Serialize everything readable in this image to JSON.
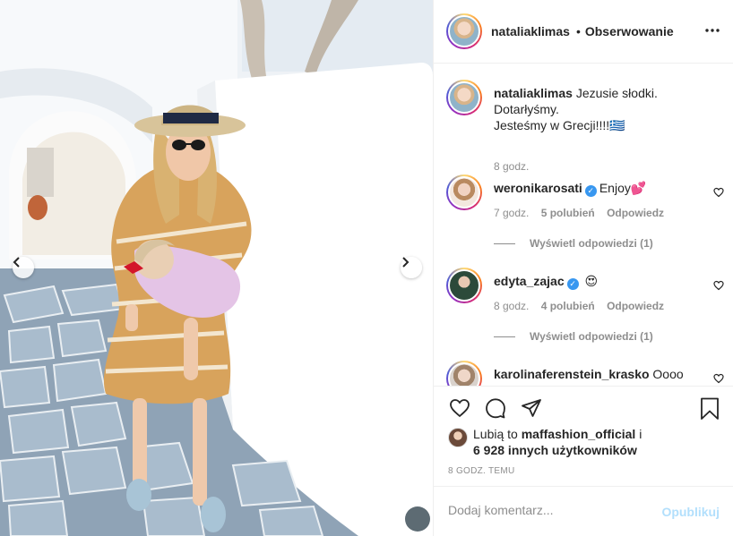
{
  "header": {
    "username": "nataliaklimas",
    "separator": "•",
    "follow_label": "Obserwowanie"
  },
  "caption": {
    "username": "nataliaklimas",
    "text_line1": "Jezusie słodki.",
    "text_line2": "Dotarłyśmy.",
    "text_line3": "Jesteśmy w Grecji!!!!🇬🇷",
    "time": "8 godz."
  },
  "comments": [
    {
      "username": "weronikarosati",
      "verified": true,
      "text": "Enjoy💕",
      "time": "7 godz.",
      "likes": "5 polubień",
      "reply_label": "Odpowiedz",
      "view_replies": "Wyświetl odpowiedzi (1)"
    },
    {
      "username": "edyta_zajac",
      "verified": true,
      "text": "😍",
      "time": "8 godz.",
      "likes": "4 polubień",
      "reply_label": "Odpowiedz",
      "view_replies": "Wyświetl odpowiedzi (1)"
    },
    {
      "username": "karolinaferenstein_krasko",
      "verified": false,
      "text": "Oooo"
    }
  ],
  "likes": {
    "prefix": "Lubią to",
    "first_user": "maffashion_official",
    "conjunction": "i",
    "others": "6 928 innych użytkowników"
  },
  "post_time": "8 GODZ. TEMU",
  "add_comment": {
    "placeholder": "Dodaj komentarz...",
    "publish_label": "Opublikuj"
  },
  "icons": {
    "verified": "✓"
  }
}
